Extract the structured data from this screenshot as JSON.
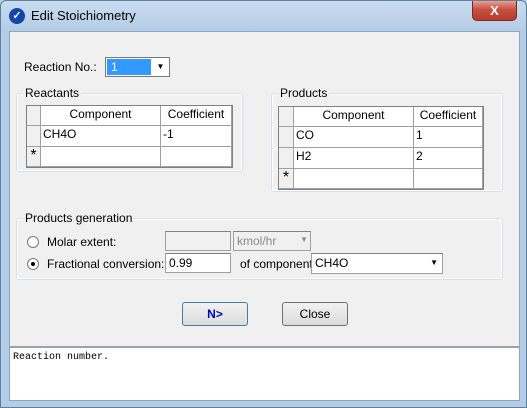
{
  "window": {
    "title": "Edit Stoichiometry",
    "close_label": "X"
  },
  "reaction": {
    "label": "Reaction No.:",
    "value": "1"
  },
  "reactants": {
    "title": "Reactants",
    "headers": [
      "Component",
      "Coefficient"
    ],
    "rows": [
      {
        "component": "CH4O",
        "coefficient": "-1"
      }
    ],
    "new_row_marker": "*"
  },
  "products": {
    "title": "Products",
    "headers": [
      "Component",
      "Coefficient"
    ],
    "rows": [
      {
        "component": "CO",
        "coefficient": "1"
      },
      {
        "component": "H2",
        "coefficient": "2"
      }
    ],
    "new_row_marker": "*"
  },
  "generation": {
    "title": "Products generation",
    "molar_extent": {
      "label": "Molar extent:",
      "value": "",
      "unit": "kmol/hr",
      "selected": false
    },
    "fractional_conversion": {
      "label": "Fractional conversion:",
      "value": "0.99",
      "selected": true
    },
    "of_component_label": "of component",
    "component": "CH4O"
  },
  "buttons": {
    "next": "N>",
    "close": "Close"
  },
  "status": {
    "message": "Reaction number."
  },
  "colors": {
    "titlebar": "#b4cce6",
    "client": "#f0f0f0",
    "next_text": "#0000c0"
  }
}
